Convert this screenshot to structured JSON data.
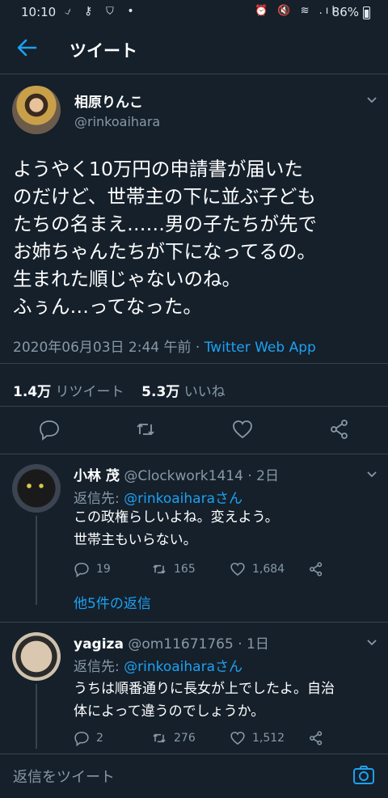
{
  "status_bar": {
    "time": "10:10",
    "left_icons": "⍻ ⚷ ⛉ •",
    "right_icons": "⏰ 🔇 ≋ .ıl",
    "battery_pct": "86%"
  },
  "header": {
    "title": "ツイート"
  },
  "main_tweet": {
    "name": "相原りんこ",
    "handle": "@rinkoaihara",
    "text": "ようやく10万円の申請書が届いた\nのだけど、世帯主の下に並ぶ子ども\nたちの名まえ……男の子たちが先で\nお姉ちゃんたちが下になってるの。\n生まれた順じゃないのね。\nふぅん…ってなった。",
    "date": "2020年06月03日 2:44 午前 · ",
    "source": "Twitter Web App",
    "retweets_count": "1.4万",
    "retweets_label": "リツイート",
    "likes_count": "5.3万",
    "likes_label": "いいね"
  },
  "replies": [
    {
      "name": "小林 茂",
      "handle": "@Clockwork1414 · 2日",
      "reply_to_label": "返信先: ",
      "reply_to": "@rinkoaiharaさん",
      "text": "この政権らしいよね。変えよう。\n世帯主もいらない。",
      "reply_count": "19",
      "retweet_count": "165",
      "like_count": "1,684",
      "more": "他5件の返信"
    },
    {
      "name": "yagiza",
      "handle": "@om11671765 · 1日",
      "reply_to_label": "返信先: ",
      "reply_to": "@rinkoaiharaさん",
      "text": "うちは順番通りに長女が上でしたよ。自治\n体によって違うのでしょうか。",
      "reply_count": "2",
      "retweet_count": "276",
      "like_count": "1,512"
    }
  ],
  "compose": {
    "placeholder": "返信をツイート"
  },
  "colors": {
    "background": "#15202b",
    "accent": "#1da1f2",
    "muted": "#8899a6",
    "divider": "#38444d"
  }
}
